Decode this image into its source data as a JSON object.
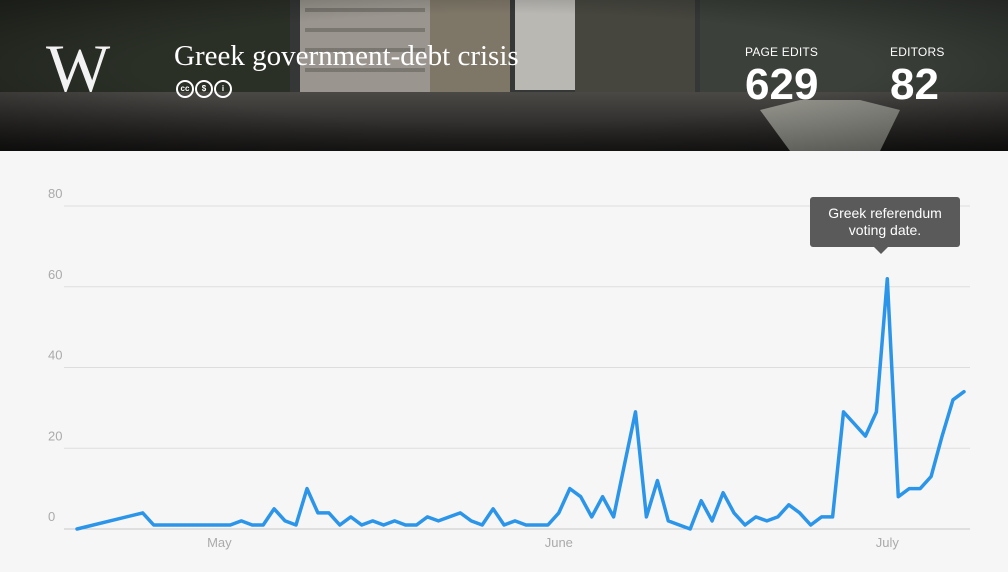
{
  "header": {
    "logo_letter": "W",
    "title": "Greek government-debt crisis",
    "license_icons": [
      "creative-commons-icon",
      "non-commercial-icon",
      "attribution-icon"
    ],
    "stats": {
      "edits_label": "PAGE EDITS",
      "edits_value": "629",
      "editors_label": "EDITORS",
      "editors_value": "82"
    }
  },
  "annotation": {
    "line1": "Greek referendum",
    "line2": "voting date."
  },
  "colors": {
    "line": "#2b95e9",
    "tooltip_bg": "#5a5a5a",
    "grid": "#dddddd"
  },
  "chart_data": {
    "type": "line",
    "title": "",
    "xlabel": "",
    "ylabel": "",
    "ylim": [
      0,
      80
    ],
    "y_ticks": [
      0,
      20,
      40,
      60,
      80
    ],
    "x_ticks": [
      {
        "label": "May",
        "date": "2015-05-01"
      },
      {
        "label": "June",
        "date": "2015-06-01"
      },
      {
        "label": "July",
        "date": "2015-07-01"
      }
    ],
    "grid": true,
    "legend": "none",
    "annotation": {
      "text": "Greek referendum voting date.",
      "date": "2015-07-01",
      "value": 62
    },
    "series": [
      {
        "dates": [
          "2015-04-18",
          "2015-04-24",
          "2015-04-25",
          "2015-04-26",
          "2015-04-27",
          "2015-04-28",
          "2015-04-29",
          "2015-04-30",
          "2015-05-01",
          "2015-05-02",
          "2015-05-03",
          "2015-05-04",
          "2015-05-05",
          "2015-05-06",
          "2015-05-07",
          "2015-05-08",
          "2015-05-09",
          "2015-05-10",
          "2015-05-11",
          "2015-05-12",
          "2015-05-13",
          "2015-05-14",
          "2015-05-15",
          "2015-05-16",
          "2015-05-17",
          "2015-05-18",
          "2015-05-19",
          "2015-05-20",
          "2015-05-21",
          "2015-05-22",
          "2015-05-23",
          "2015-05-24",
          "2015-05-25",
          "2015-05-26",
          "2015-05-27",
          "2015-05-28",
          "2015-05-29",
          "2015-05-30",
          "2015-05-31",
          "2015-06-01",
          "2015-06-02",
          "2015-06-03",
          "2015-06-04",
          "2015-06-05",
          "2015-06-06",
          "2015-06-07",
          "2015-06-08",
          "2015-06-09",
          "2015-06-10",
          "2015-06-11",
          "2015-06-12",
          "2015-06-13",
          "2015-06-14",
          "2015-06-15",
          "2015-06-16",
          "2015-06-17",
          "2015-06-18",
          "2015-06-19",
          "2015-06-20",
          "2015-06-21",
          "2015-06-22",
          "2015-06-23",
          "2015-06-24",
          "2015-06-25",
          "2015-06-26",
          "2015-06-27",
          "2015-06-28",
          "2015-06-29",
          "2015-06-30",
          "2015-07-01",
          "2015-07-02",
          "2015-07-03",
          "2015-07-04",
          "2015-07-05",
          "2015-07-06",
          "2015-07-07",
          "2015-07-08"
        ],
        "values": [
          0,
          4,
          1,
          1,
          1,
          1,
          1,
          1,
          1,
          1,
          2,
          1,
          1,
          5,
          2,
          1,
          10,
          4,
          4,
          1,
          3,
          1,
          2,
          1,
          2,
          1,
          1,
          3,
          2,
          3,
          4,
          2,
          1,
          5,
          1,
          2,
          1,
          1,
          1,
          4,
          10,
          8,
          3,
          8,
          3,
          16,
          29,
          3,
          12,
          2,
          1,
          0,
          7,
          2,
          9,
          4,
          1,
          3,
          2,
          3,
          6,
          4,
          1,
          3,
          3,
          29,
          26,
          23,
          29,
          62,
          8,
          10,
          10,
          13,
          23,
          32,
          34
        ]
      }
    ]
  }
}
